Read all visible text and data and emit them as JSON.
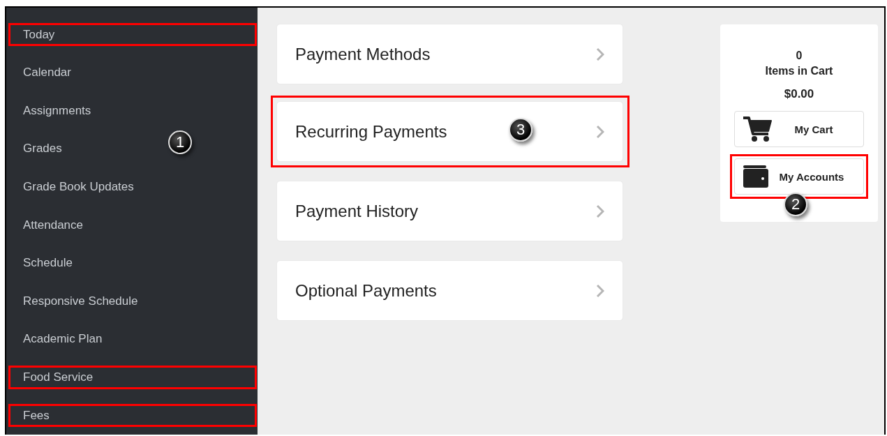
{
  "sidebar": {
    "callout": "1",
    "items": [
      {
        "label": "Today",
        "highlighted": true
      },
      {
        "label": "Calendar",
        "highlighted": false
      },
      {
        "label": "Assignments",
        "highlighted": false
      },
      {
        "label": "Grades",
        "highlighted": false
      },
      {
        "label": "Grade Book Updates",
        "highlighted": false
      },
      {
        "label": "Attendance",
        "highlighted": false
      },
      {
        "label": "Schedule",
        "highlighted": false
      },
      {
        "label": "Responsive Schedule",
        "highlighted": false
      },
      {
        "label": "Academic Plan",
        "highlighted": false
      },
      {
        "label": "Food Service",
        "highlighted": true
      },
      {
        "label": "Fees",
        "highlighted": true
      }
    ]
  },
  "payment_menu": {
    "items": [
      {
        "label": "Payment Methods",
        "highlighted": false
      },
      {
        "label": "Recurring Payments",
        "highlighted": true,
        "callout": "3"
      },
      {
        "label": "Payment History",
        "highlighted": false
      },
      {
        "label": "Optional Payments",
        "highlighted": false
      }
    ]
  },
  "cart": {
    "count": "0",
    "count_label": "Items in Cart",
    "total": "$0.00",
    "buttons": [
      {
        "kind": "cart",
        "label": "My Cart",
        "highlighted": false
      },
      {
        "kind": "wallet",
        "label": "My Accounts",
        "highlighted": true,
        "callout": "2"
      }
    ]
  }
}
